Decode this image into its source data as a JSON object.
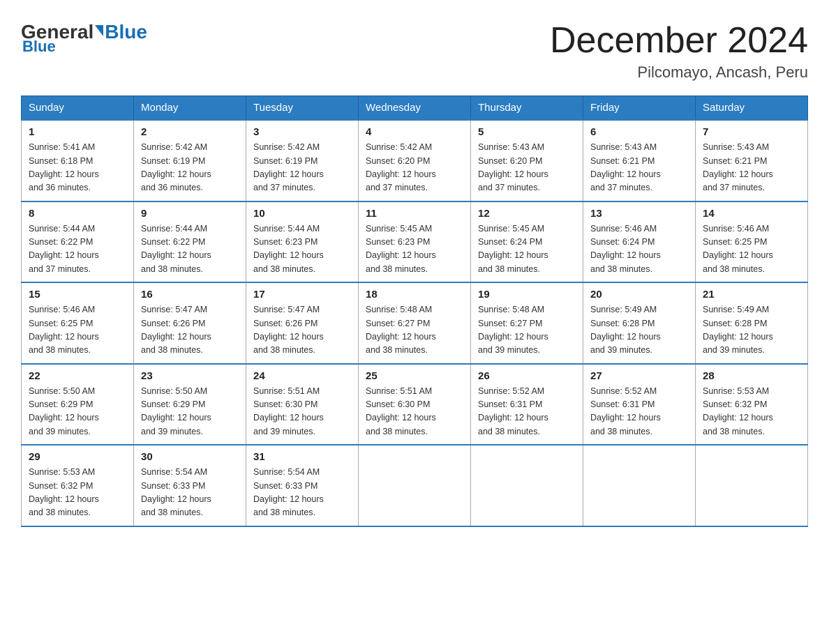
{
  "header": {
    "logo": {
      "general": "General",
      "blue": "Blue"
    },
    "title": "December 2024",
    "location": "Pilcomayo, Ancash, Peru"
  },
  "days_of_week": [
    "Sunday",
    "Monday",
    "Tuesday",
    "Wednesday",
    "Thursday",
    "Friday",
    "Saturday"
  ],
  "weeks": [
    [
      {
        "day": "1",
        "sunrise": "5:41 AM",
        "sunset": "6:18 PM",
        "daylight": "12 hours and 36 minutes."
      },
      {
        "day": "2",
        "sunrise": "5:42 AM",
        "sunset": "6:19 PM",
        "daylight": "12 hours and 36 minutes."
      },
      {
        "day": "3",
        "sunrise": "5:42 AM",
        "sunset": "6:19 PM",
        "daylight": "12 hours and 37 minutes."
      },
      {
        "day": "4",
        "sunrise": "5:42 AM",
        "sunset": "6:20 PM",
        "daylight": "12 hours and 37 minutes."
      },
      {
        "day": "5",
        "sunrise": "5:43 AM",
        "sunset": "6:20 PM",
        "daylight": "12 hours and 37 minutes."
      },
      {
        "day": "6",
        "sunrise": "5:43 AM",
        "sunset": "6:21 PM",
        "daylight": "12 hours and 37 minutes."
      },
      {
        "day": "7",
        "sunrise": "5:43 AM",
        "sunset": "6:21 PM",
        "daylight": "12 hours and 37 minutes."
      }
    ],
    [
      {
        "day": "8",
        "sunrise": "5:44 AM",
        "sunset": "6:22 PM",
        "daylight": "12 hours and 37 minutes."
      },
      {
        "day": "9",
        "sunrise": "5:44 AM",
        "sunset": "6:22 PM",
        "daylight": "12 hours and 38 minutes."
      },
      {
        "day": "10",
        "sunrise": "5:44 AM",
        "sunset": "6:23 PM",
        "daylight": "12 hours and 38 minutes."
      },
      {
        "day": "11",
        "sunrise": "5:45 AM",
        "sunset": "6:23 PM",
        "daylight": "12 hours and 38 minutes."
      },
      {
        "day": "12",
        "sunrise": "5:45 AM",
        "sunset": "6:24 PM",
        "daylight": "12 hours and 38 minutes."
      },
      {
        "day": "13",
        "sunrise": "5:46 AM",
        "sunset": "6:24 PM",
        "daylight": "12 hours and 38 minutes."
      },
      {
        "day": "14",
        "sunrise": "5:46 AM",
        "sunset": "6:25 PM",
        "daylight": "12 hours and 38 minutes."
      }
    ],
    [
      {
        "day": "15",
        "sunrise": "5:46 AM",
        "sunset": "6:25 PM",
        "daylight": "12 hours and 38 minutes."
      },
      {
        "day": "16",
        "sunrise": "5:47 AM",
        "sunset": "6:26 PM",
        "daylight": "12 hours and 38 minutes."
      },
      {
        "day": "17",
        "sunrise": "5:47 AM",
        "sunset": "6:26 PM",
        "daylight": "12 hours and 38 minutes."
      },
      {
        "day": "18",
        "sunrise": "5:48 AM",
        "sunset": "6:27 PM",
        "daylight": "12 hours and 38 minutes."
      },
      {
        "day": "19",
        "sunrise": "5:48 AM",
        "sunset": "6:27 PM",
        "daylight": "12 hours and 39 minutes."
      },
      {
        "day": "20",
        "sunrise": "5:49 AM",
        "sunset": "6:28 PM",
        "daylight": "12 hours and 39 minutes."
      },
      {
        "day": "21",
        "sunrise": "5:49 AM",
        "sunset": "6:28 PM",
        "daylight": "12 hours and 39 minutes."
      }
    ],
    [
      {
        "day": "22",
        "sunrise": "5:50 AM",
        "sunset": "6:29 PM",
        "daylight": "12 hours and 39 minutes."
      },
      {
        "day": "23",
        "sunrise": "5:50 AM",
        "sunset": "6:29 PM",
        "daylight": "12 hours and 39 minutes."
      },
      {
        "day": "24",
        "sunrise": "5:51 AM",
        "sunset": "6:30 PM",
        "daylight": "12 hours and 39 minutes."
      },
      {
        "day": "25",
        "sunrise": "5:51 AM",
        "sunset": "6:30 PM",
        "daylight": "12 hours and 38 minutes."
      },
      {
        "day": "26",
        "sunrise": "5:52 AM",
        "sunset": "6:31 PM",
        "daylight": "12 hours and 38 minutes."
      },
      {
        "day": "27",
        "sunrise": "5:52 AM",
        "sunset": "6:31 PM",
        "daylight": "12 hours and 38 minutes."
      },
      {
        "day": "28",
        "sunrise": "5:53 AM",
        "sunset": "6:32 PM",
        "daylight": "12 hours and 38 minutes."
      }
    ],
    [
      {
        "day": "29",
        "sunrise": "5:53 AM",
        "sunset": "6:32 PM",
        "daylight": "12 hours and 38 minutes."
      },
      {
        "day": "30",
        "sunrise": "5:54 AM",
        "sunset": "6:33 PM",
        "daylight": "12 hours and 38 minutes."
      },
      {
        "day": "31",
        "sunrise": "5:54 AM",
        "sunset": "6:33 PM",
        "daylight": "12 hours and 38 minutes."
      },
      null,
      null,
      null,
      null
    ]
  ]
}
